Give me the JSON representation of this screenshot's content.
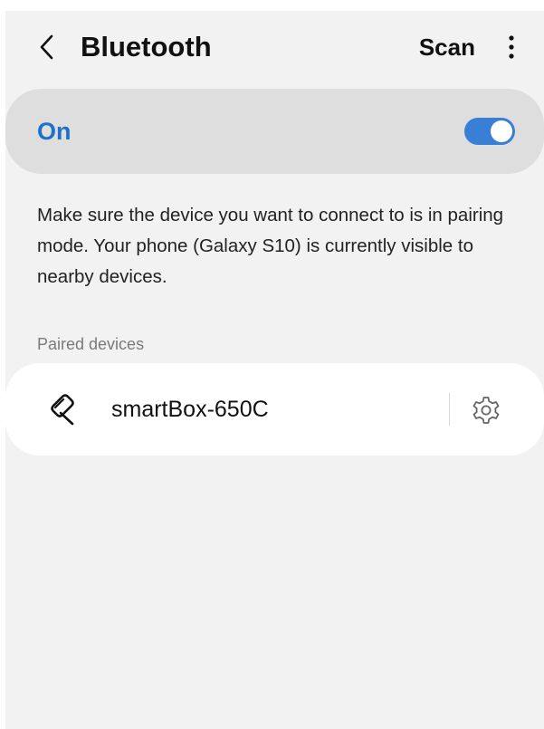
{
  "header": {
    "back_icon": "chevron-left-icon",
    "title": "Bluetooth",
    "scan_label": "Scan",
    "more_icon": "more-vertical-icon"
  },
  "bluetooth_toggle": {
    "label": "On",
    "state": "on",
    "accent_color": "#3a7fd6",
    "label_color": "#1e70c9"
  },
  "description": "Make sure the device you want to connect to is in pairing mode. Your phone (Galaxy S10) is currently visible to nearby devices.",
  "paired_devices": {
    "section_label": "Paired devices",
    "items": [
      {
        "name": "smartBox-650C",
        "icon": "headset-icon",
        "settings_icon": "gear-icon"
      }
    ]
  }
}
